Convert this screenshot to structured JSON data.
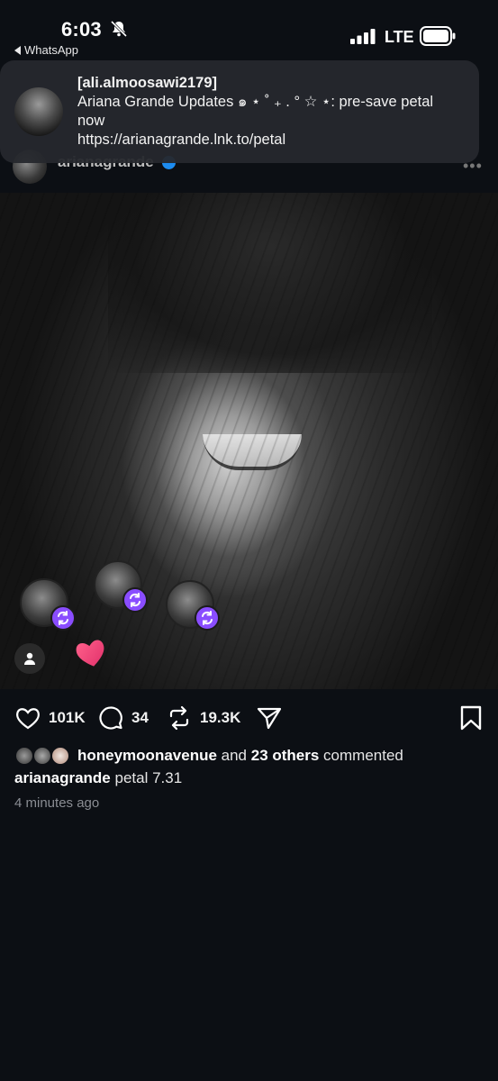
{
  "status_bar": {
    "time": "6:03",
    "back_app": "WhatsApp",
    "network": "LTE"
  },
  "notification": {
    "sender": "[ali.almoosawi2179]",
    "line2": "Ariana Grande Updates ๑ ⋆ ˚ ₊ . ° ☆ ⋆: pre-save petal",
    "line3": "now",
    "line4": "https://arianagrande.lnk.to/petal"
  },
  "post": {
    "username": "arianagrande",
    "actions": {
      "likes": "101K",
      "comments": "34",
      "reposts": "19.3K"
    },
    "commenters": {
      "first": "honeymoonavenue",
      "connector": " and ",
      "others": "23 others",
      "suffix": " commented"
    },
    "caption_user": "arianagrande",
    "caption_text": " petal 7.31",
    "timestamp": "4 minutes ago"
  },
  "colors": {
    "background": "#0c0f14",
    "repost_badge": "#8a4dff",
    "heart": "#f0437a",
    "verified": "#1d8cf0"
  },
  "icons": [
    "bell-slash-icon",
    "signal-icon",
    "battery-icon",
    "verified-icon",
    "more-icon",
    "repost-icon",
    "profile-icon",
    "heart-icon",
    "comment-icon",
    "send-icon",
    "bookmark-icon"
  ]
}
